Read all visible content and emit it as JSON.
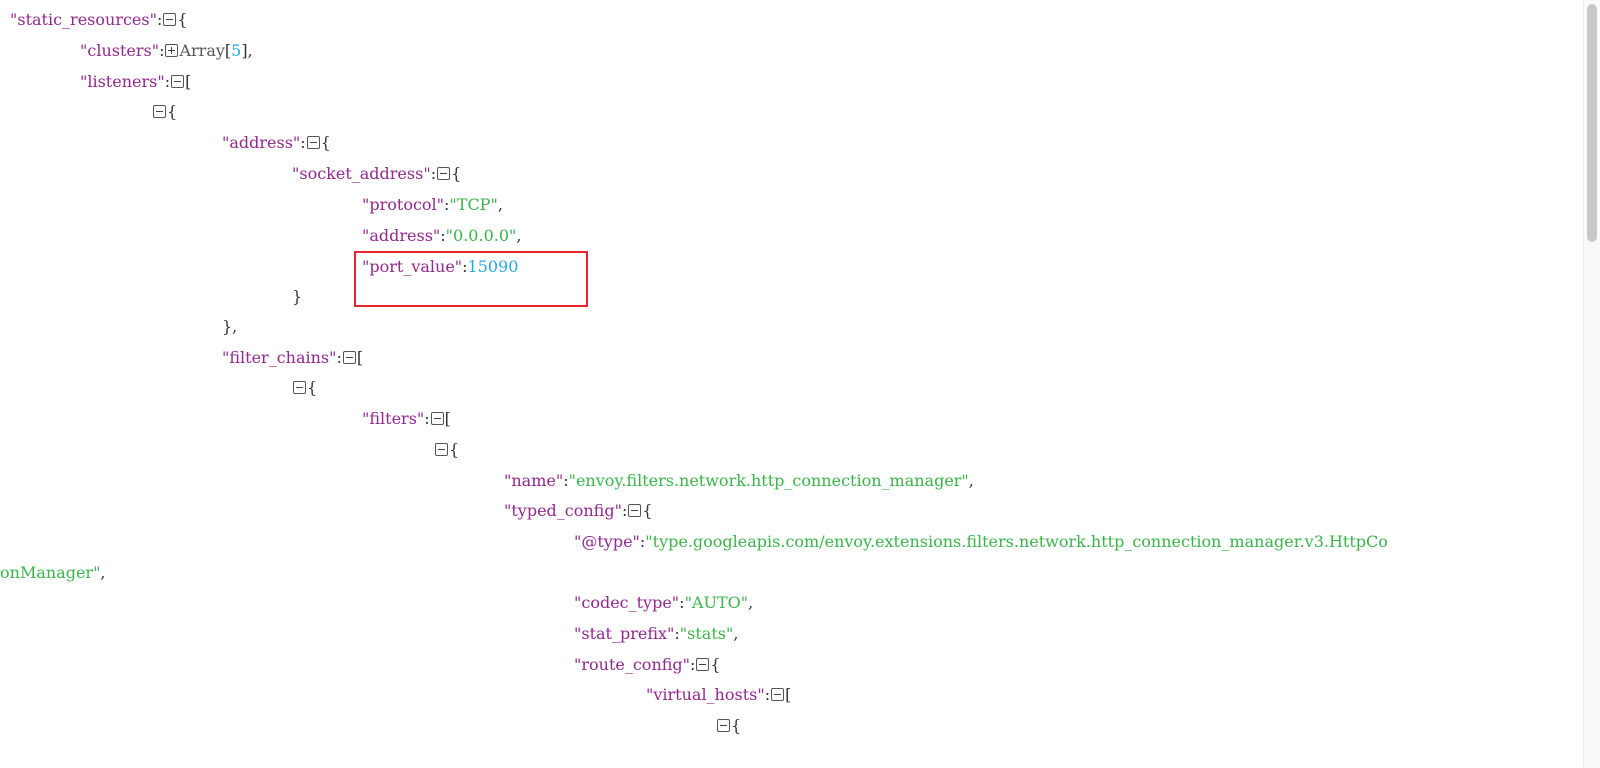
{
  "json_tree": {
    "static_resources": {
      "key": "\"static_resources\"",
      "open": "{"
    },
    "clusters": {
      "key": "\"clusters\"",
      "collapsed": "Array",
      "count": "5",
      "comma": ","
    },
    "listeners": {
      "key": "\"listeners\"",
      "open": "["
    },
    "listener_0": {
      "open": "{"
    },
    "address": {
      "key": "\"address\"",
      "open": "{"
    },
    "socket_address": {
      "key": "\"socket_address\"",
      "open": "{"
    },
    "protocol": {
      "key": "\"protocol\"",
      "value": "\"TCP\"",
      "comma": ","
    },
    "address_value": {
      "key": "\"address\"",
      "value": "\"0.0.0.0\"",
      "comma": ","
    },
    "port_value": {
      "key": "\"port_value\"",
      "value": "15090"
    },
    "socket_address_close": "}",
    "address_close": "},",
    "filter_chains": {
      "key": "\"filter_chains\"",
      "open": "["
    },
    "filter_chain_0": {
      "open": "{"
    },
    "filters": {
      "key": "\"filters\"",
      "open": "["
    },
    "filter_0": {
      "open": "{"
    },
    "name": {
      "key": "\"name\"",
      "value": "\"envoy.filters.network.http_connection_manager\"",
      "comma": ","
    },
    "typed_config": {
      "key": "\"typed_config\"",
      "open": "{"
    },
    "type": {
      "key": "\"@type\"",
      "value_part1": "\"type.googleapis.com/envoy.extensions.filters.network.http_connection_manager.v3.HttpCo",
      "value_part2": "onManager\"",
      "comma": ","
    },
    "codec_type": {
      "key": "\"codec_type\"",
      "value": "\"AUTO\"",
      "comma": ","
    },
    "stat_prefix": {
      "key": "\"stat_prefix\"",
      "value": "\"stats\"",
      "comma": ","
    },
    "route_config": {
      "key": "\"route_config\"",
      "open": "{"
    },
    "virtual_hosts": {
      "key": "\"virtual_hosts\"",
      "open": "["
    },
    "virtual_host_0": {
      "open": "{"
    }
  },
  "colors": {
    "key": "#92278f",
    "string": "#3ab54a",
    "number": "#25aae2",
    "highlight": "#e5262b"
  },
  "icons": {
    "expand": "plus-square-icon",
    "collapse": "minus-square-icon"
  }
}
